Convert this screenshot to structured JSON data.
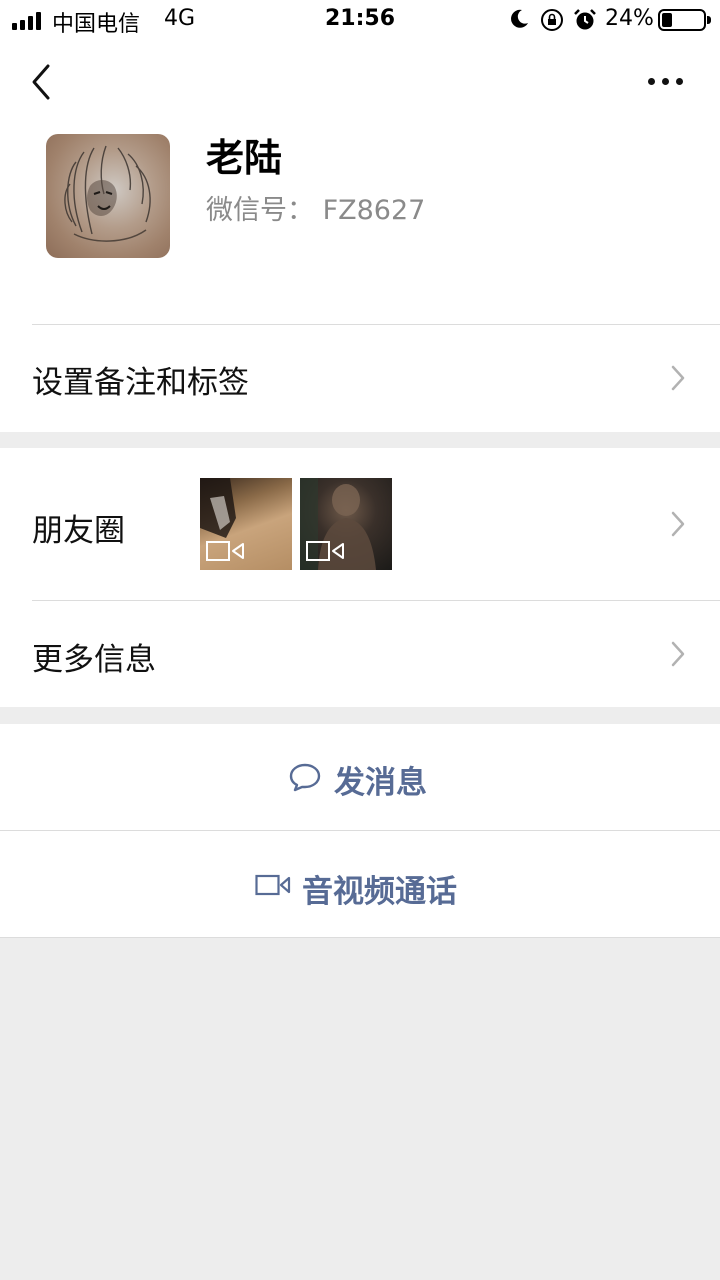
{
  "status": {
    "carrier": "中国电信",
    "network": "4G",
    "time": "21:56",
    "battery_pct": "24%",
    "battery_level": 0.24
  },
  "profile": {
    "name": "老陆",
    "wechat_id": "微信号： FZ8627"
  },
  "rows": {
    "remark": "设置备注和标签",
    "moments": "朋友圈",
    "more_info": "更多信息"
  },
  "actions": {
    "message": "发消息",
    "call": "音视频通话"
  },
  "colors": {
    "link": "#576b95",
    "background": "#ededed"
  }
}
